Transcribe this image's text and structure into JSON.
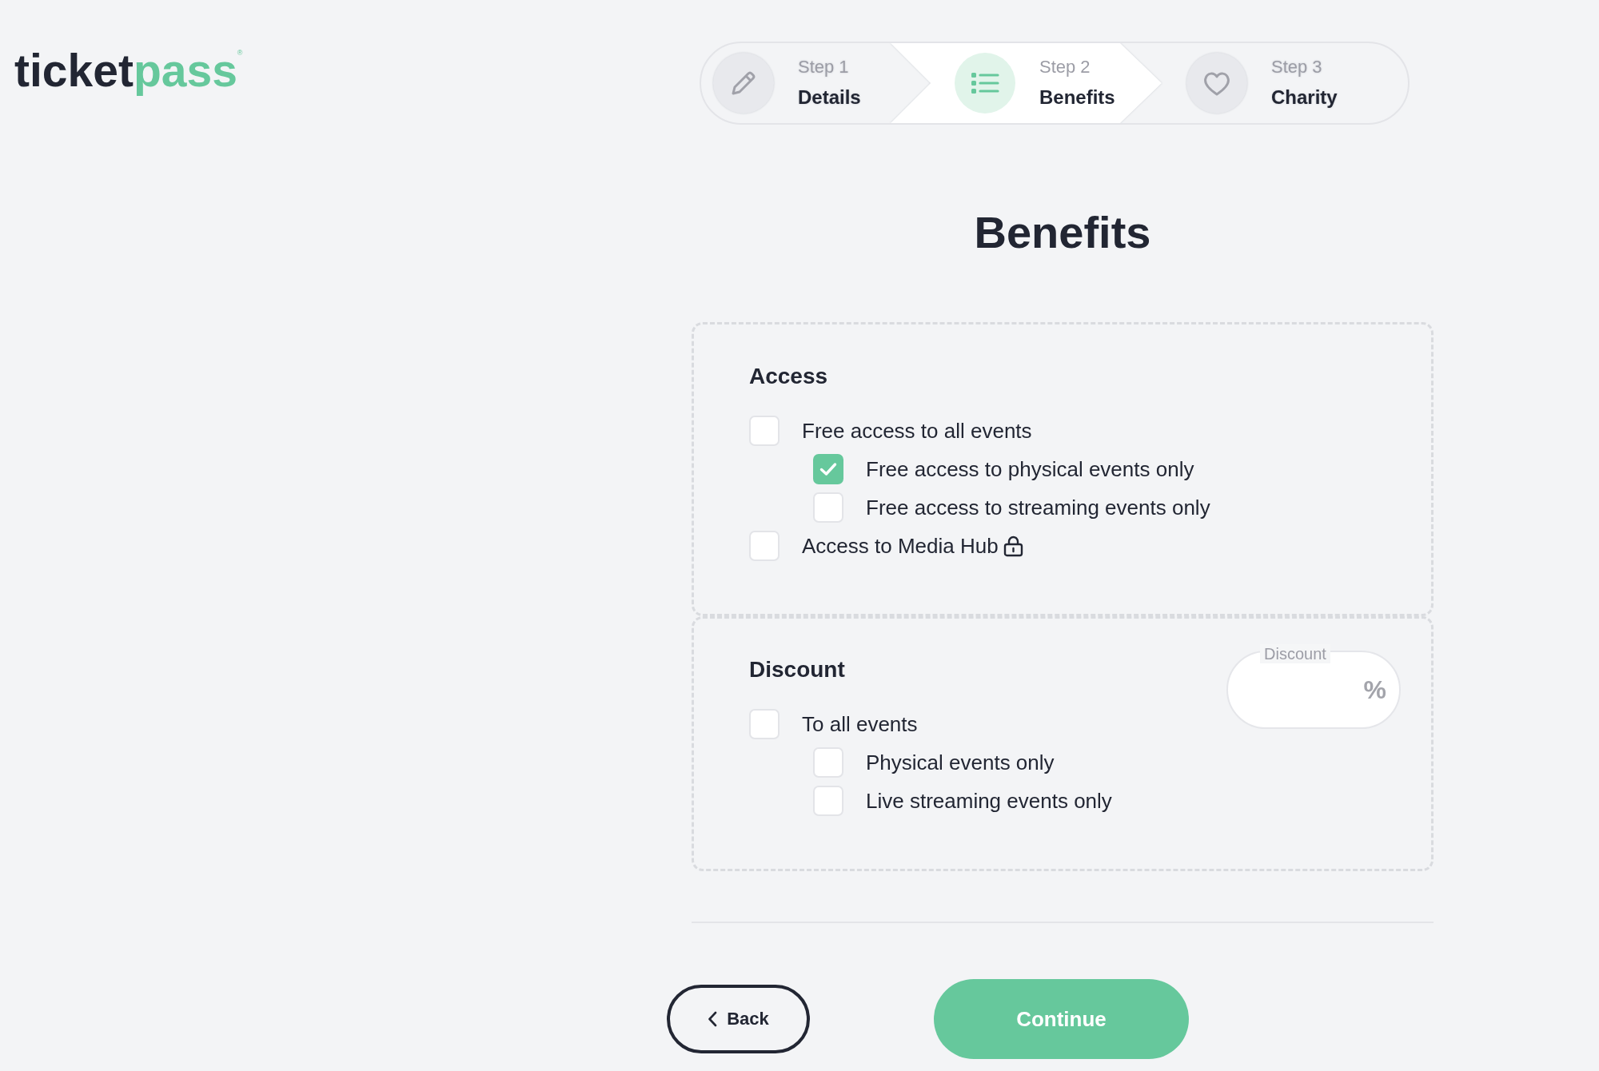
{
  "logo": {
    "primary": "ticket",
    "accent": "pass",
    "registered": "®"
  },
  "steps": [
    {
      "step": "Step 1",
      "title": "Details",
      "selected": false
    },
    {
      "step": "Step 2",
      "title": "Benefits",
      "selected": true
    },
    {
      "step": "Step 3",
      "title": "Charity",
      "selected": false
    }
  ],
  "heading": "Benefits",
  "access": {
    "title": "Access",
    "options": [
      {
        "label": "Free access to all events",
        "checked": false,
        "locked": false,
        "children": [
          {
            "label": "Free access to physical events only",
            "checked": true,
            "locked": false
          },
          {
            "label": "Free access to streaming events only",
            "checked": false,
            "locked": false
          }
        ]
      },
      {
        "label": "Access to Media Hub",
        "checked": false,
        "locked": true
      }
    ]
  },
  "discount": {
    "title": "Discount",
    "options": [
      {
        "label": "To all events",
        "checked": false,
        "locked": false,
        "children": [
          {
            "label": "Physical events only",
            "checked": false,
            "locked": false
          },
          {
            "label": "Live streaming events only",
            "checked": false,
            "locked": false
          }
        ]
      }
    ],
    "field": {
      "label": "Discount",
      "suffix": "%"
    }
  },
  "buttons": [
    {
      "kind": "back",
      "label": "Back"
    },
    {
      "kind": "primary",
      "label": "Continue"
    }
  ]
}
